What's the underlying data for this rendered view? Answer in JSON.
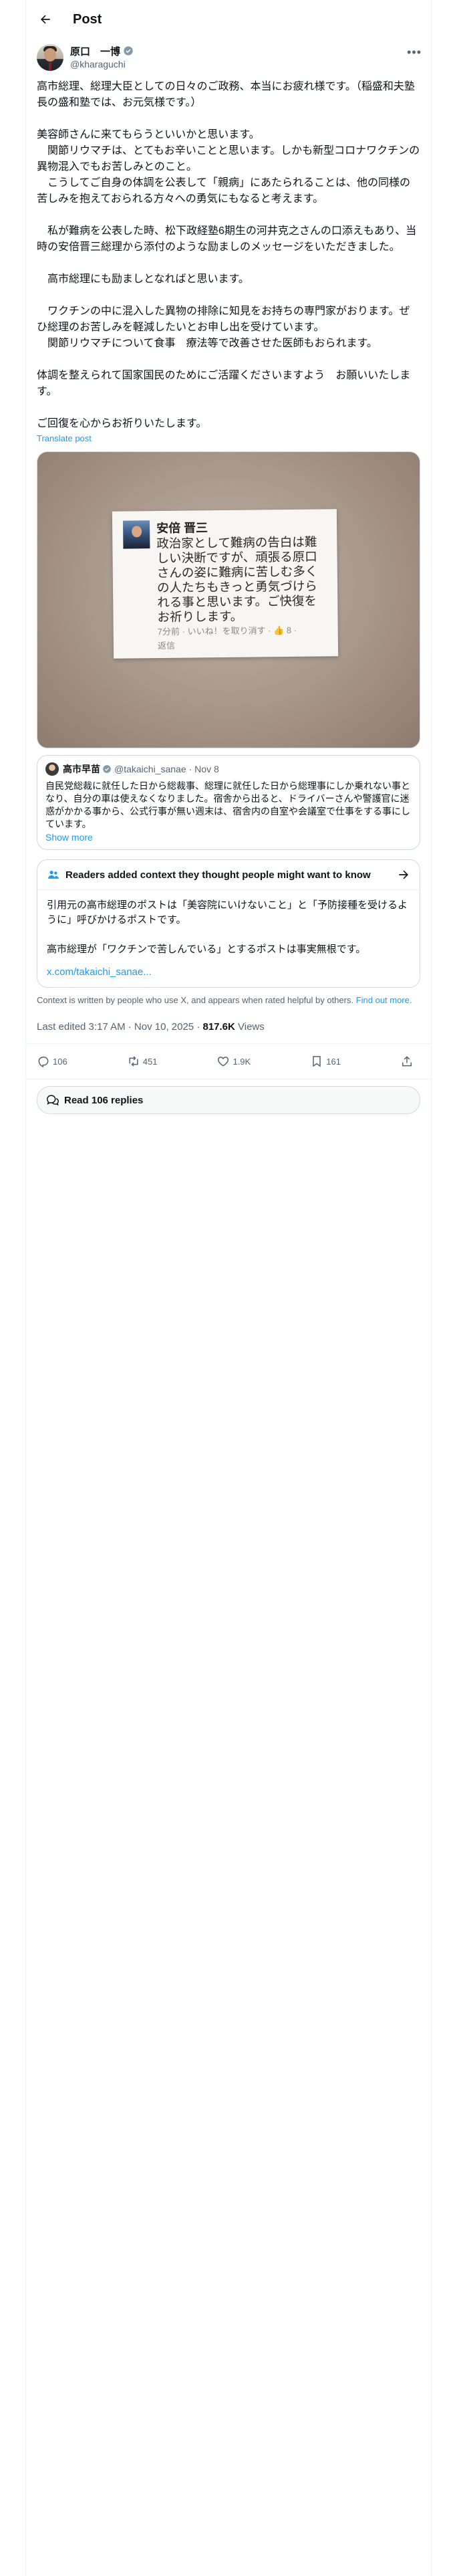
{
  "header": {
    "title": "Post"
  },
  "author": {
    "name": "原口　一博",
    "handle": "@kharaguchi"
  },
  "post": {
    "text": "高市総理、総理大臣としての日々のご政務、本当にお疲れ様です。（稲盛和夫塾長の盛和塾では、お元気様です。）\n\n美容師さんに来てもらうといいかと思います。\n　関節リウマチは、とてもお辛いことと思います。しかも新型コロナワクチンの異物混入でもお苦しみとのこと。\n　こうしてご自身の体調を公表して「親病」にあたられることは、他の同様の苦しみを抱えておられる方々への勇気にもなると考えます。\n\n　私が難病を公表した時、松下政経塾6期生の河井克之さんの口添えもあり、当時の安倍晋三総理から添付のような励ましのメッセージをいただきました。\n\n　高市総理にも励ましとなればと思います。\n\n　ワクチンの中に混入した異物の排除に知見をお持ちの専門家がおります。ぜひ総理のお苦しみを軽減したいとお申し出を受けています。\n　関節リウマチについて食事　療法等で改善させた医師もおられます。\n\n体調を整えられて国家国民のためにご活躍くださいますよう　お願いいたします。\n\nご回復を心からお祈りいたします。",
    "translate_label": "Translate post"
  },
  "photo_note": {
    "name": "安倍 晋三",
    "text": "政治家として難病の告白は難しい決断ですが、頑張る原口さんの姿に難病に苦しむ多くの人たちもきっと勇気づけられる事と思います。ご快復を お祈りします。",
    "meta_line1": "7分前 · いいね！を取り消す · 👍 8 ·",
    "meta_line2": "返信"
  },
  "quote": {
    "name": "高市早苗",
    "handle": "@takaichi_sanae",
    "date": "· Nov 8",
    "text": "自民党総裁に就任した日から総裁事、総理に就任した日から総理事にしか乗れない事となり、自分の車は使えなくなりました。宿舎から出ると、ドライバーさんや警護官に迷惑がかかる事から、公式行事が無い週末は、宿舎内の自室や会議室で仕事をする事にしています。",
    "show_more": "Show more"
  },
  "context": {
    "title": "Readers added context they thought people might want to know",
    "body": "引用元の高市総理のポストは「美容院にいけないこと」と「予防接種を受けるように」呼びかけるポストです。\n\n高市総理が「ワクチンで苦しんでいる」とするポストは事実無根です。",
    "link": "x.com/takaichi_sanae...",
    "footer": "Context is written by people who use X, and appears when rated helpful by others.",
    "footer_link": "Find out more."
  },
  "meta": {
    "edited": "Last edited 3:17 AM · Nov 10, 2025 · ",
    "views_count": "817.6K",
    "views_label": " Views"
  },
  "actions": {
    "replies": "106",
    "reposts": "451",
    "likes": "1.9K",
    "bookmarks": "161"
  },
  "read_replies": "Read 106 replies",
  "colors": {
    "accent": "#1d9bf0",
    "muted": "#536471",
    "border": "#cfd9de",
    "verified": "#829aab"
  }
}
